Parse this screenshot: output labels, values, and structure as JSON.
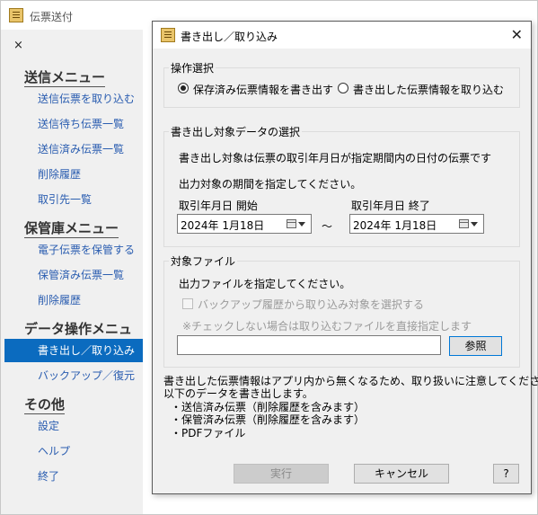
{
  "main_window": {
    "title": "伝票送付",
    "close_label": "×",
    "menu": [
      {
        "heading": "送信メニュー",
        "items": [
          "送信伝票を取り込む",
          "送信待ち伝票一覧",
          "送信済み伝票一覧",
          "削除履歴",
          "取引先一覧"
        ]
      },
      {
        "heading": "保管庫メニュー",
        "items": [
          "電子伝票を保管する",
          "保管済み伝票一覧",
          "削除履歴"
        ]
      },
      {
        "heading": "データ操作メニュー",
        "items": [
          "書き出し／取り込み",
          "バックアップ／復元"
        ]
      },
      {
        "heading": "その他",
        "items": [
          "設定",
          "ヘルプ",
          "終了"
        ]
      }
    ],
    "active_item": "書き出し／取り込み"
  },
  "dialog": {
    "title": "書き出し／取り込み",
    "close_label": "✕",
    "operation": {
      "label": "操作選択",
      "options": [
        "保存済み伝票情報を書き出す",
        "書き出した伝票情報を取り込む"
      ],
      "selected": 0
    },
    "target_data": {
      "label": "書き出し対象データの選択",
      "desc1": "書き出し対象は伝票の取引年月日が指定期間内の日付の伝票です",
      "desc2": "出力対象の期間を指定してください。",
      "start_label": "取引年月日 開始",
      "start_value": "2024年  1月18日",
      "end_label": "取引年月日 終了",
      "end_value": "2024年  1月18日",
      "range_sep": "～"
    },
    "target_file": {
      "label": "対象ファイル",
      "desc": "出力ファイルを指定してください。",
      "checkbox_label": "バックアップ履歴から取り込み対象を選択する",
      "note": "※チェックしない場合は取り込むファイルを直接指定します",
      "path_value": "",
      "browse_label": "参照"
    },
    "notice": [
      "書き出した伝票情報はアプリ内から無くなるため、取り扱いに注意してください。",
      "以下のデータを書き出します。",
      "・送信済み伝票（削除履歴を含みます）",
      "・保管済み伝票（削除履歴を含みます）",
      "・PDFファイル"
    ],
    "buttons": {
      "execute": "実行",
      "cancel": "キャンセル",
      "help": "?"
    }
  }
}
